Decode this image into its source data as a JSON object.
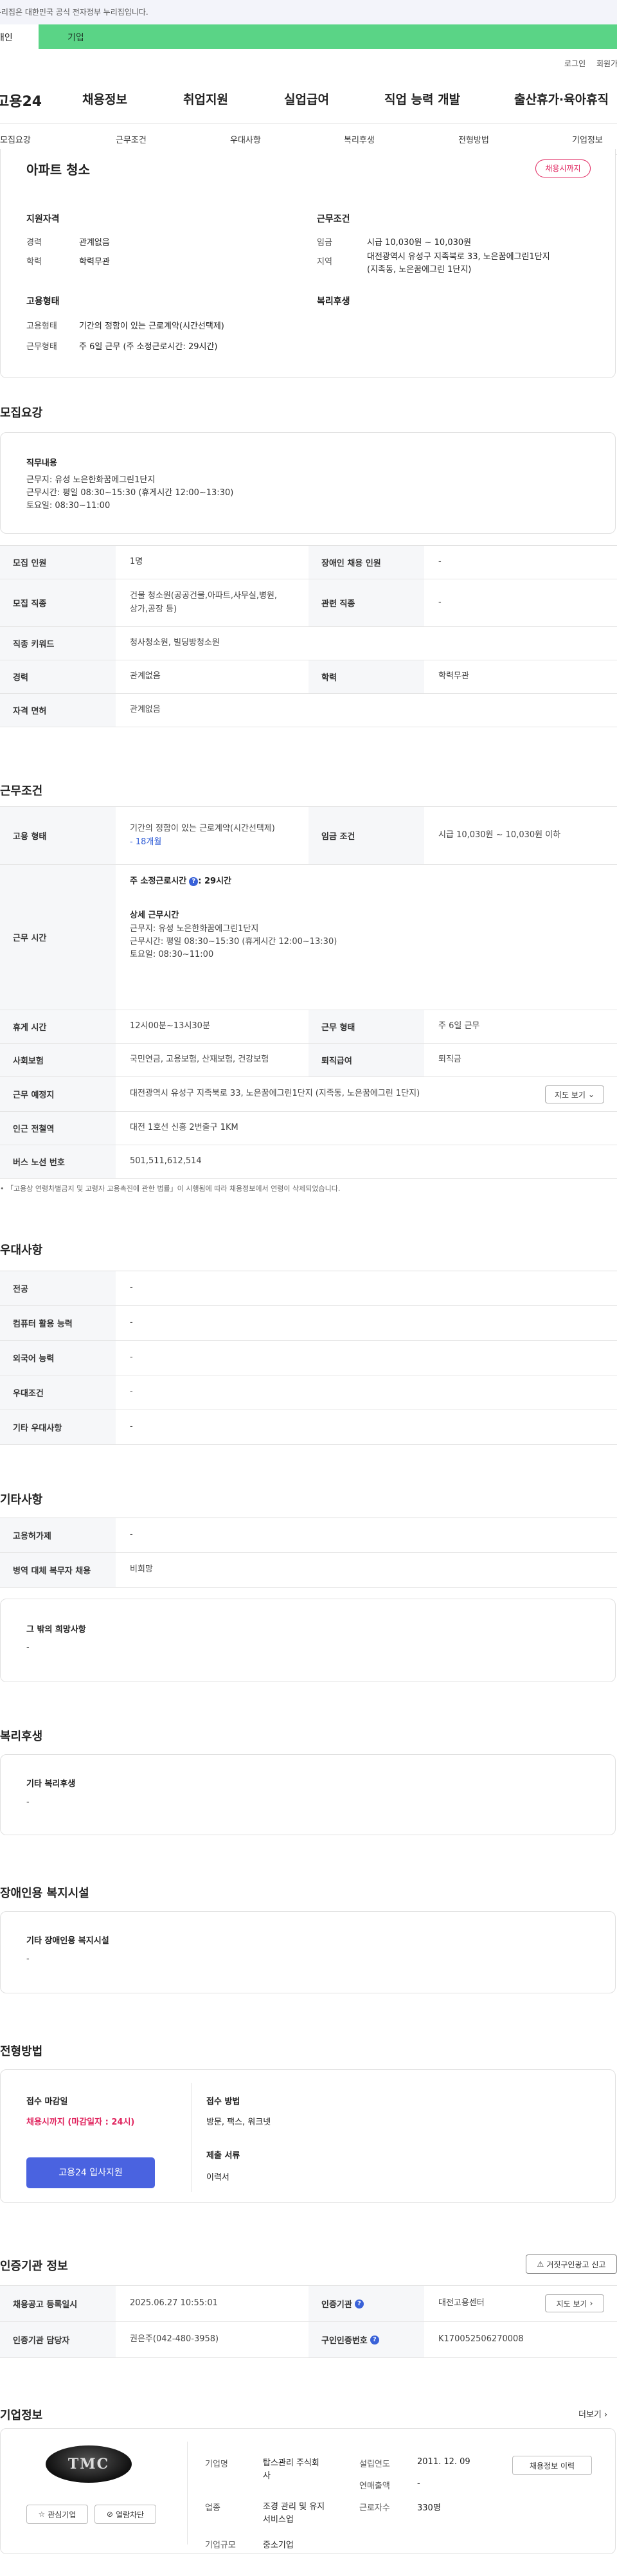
{
  "gov_banner": "이 누리집은 대한민국 공식 전자정부 누리집입니다.",
  "audience_tabs": [
    "개인",
    "기업"
  ],
  "util": {
    "login": "로그인",
    "join": "회원가입"
  },
  "logo": "고용24",
  "gnb": [
    "채용정보",
    "취업지원",
    "실업급여",
    "직업 능력 개발",
    "출산휴가·육아휴직"
  ],
  "tabs": [
    "모집요강",
    "근무조건",
    "우대사항",
    "복리후생",
    "전형방법",
    "기업정보"
  ],
  "summary": {
    "title": "아파트 청소",
    "badge": "채용시까지",
    "qual_heading": "지원자격",
    "career_label": "경력",
    "career_value": "관계없음",
    "edu_label": "학력",
    "edu_value": "학력무관",
    "cond_heading": "근무조건",
    "wage_label": "임금",
    "wage_value": "시급 10,030원 ~ 10,030원",
    "region_label": "지역",
    "region_value": "대전광역시 유성구 지족북로 33, 노은꿈에그린1단지\n(지족동, 노은꿈에그린 1단지)",
    "emp_heading": "고용형태",
    "type_label": "고용형태",
    "type_value": "기간의 정함이 있는 근로계약(시간선택제)",
    "form_label": "근무형태",
    "form_value": "주 6일 근무 (주 소정근로시간: 29시간)",
    "welfare_heading": "복리후생"
  },
  "recruit": {
    "heading": "모집요강",
    "duty_title": "직무내용",
    "duty_text": "근무지: 유성 노은한화꿈에그린1단지\n근무시간: 평일 08:30~15:30 (휴게시간 12:00~13:30)\n토요일: 08:30~11:00",
    "rows": [
      {
        "k1": "모집 인원",
        "v1": "1명",
        "k2": "장애인 채용 인원",
        "v2": "-"
      },
      {
        "k1": "모집 직종",
        "v1": "건물 청소원(공공건물,아파트,사무실,병원,\n상가,공장 등)",
        "k2": "관련 직종",
        "v2": "-"
      },
      {
        "k1": "직종 키워드",
        "v1": "청사청소원, 빌딩방청소원",
        "k2": "",
        "v2": ""
      },
      {
        "k1": "경력",
        "v1": "관계없음",
        "k2": "학력",
        "v2": "학력무관"
      },
      {
        "k1": "자격 면허",
        "v1": "관계없음",
        "k2": "",
        "v2": ""
      }
    ]
  },
  "work": {
    "heading": "근무조건",
    "emp_type_k": "고용 형태",
    "emp_type_v": "기간의 정함이 있는 근로계약(시간선택제)",
    "emp_type_period": "- 18개월",
    "wage_k": "임금 조건",
    "wage_v": "시급 10,030원 ~ 10,030원 이하",
    "hours_k": "근무 시간",
    "hours_week": "주 소정근로시간",
    "hours_week_val": ": 29시간",
    "hours_detail_title": "상세 근무시간",
    "hours_detail": "근무지: 유성 노은한화꿈에그린1단지\n근무시간: 평일 08:30~15:30 (휴게시간 12:00~13:30)\n토요일: 08:30~11:00",
    "break_k": "휴게 시간",
    "break_v": "12시00분~13시30분",
    "form_k": "근무 형태",
    "form_v": "주 6일 근무",
    "ins_k": "사회보험",
    "ins_v": "국민연금, 고용보험, 산재보험, 건강보험",
    "sev_k": "퇴직급여",
    "sev_v": "퇴직금",
    "place_k": "근무 예정지",
    "place_v": "대전광역시 유성구 지족북로 33, 노은꿈에그린1단지 (지족동, 노은꿈에그린 1단지)",
    "map_btn": "지도 보기",
    "subway_k": "인근 전철역",
    "subway_v": "대전 1호선 신흥 2번출구 1KM",
    "bus_k": "버스 노선 번호",
    "bus_v": "501,511,612,514",
    "note": "「고용상 연령차별금지 및 고령자 고용촉진에 관한 법률」이 시행됨에 따라 채용정보에서 연령이 삭제되었습니다."
  },
  "pref": {
    "heading": "우대사항",
    "rows": [
      {
        "k": "전공",
        "v": "-"
      },
      {
        "k": "컴퓨터 활용 능력",
        "v": "-"
      },
      {
        "k": "외국어 능력",
        "v": "-"
      },
      {
        "k": "우대조건",
        "v": "-"
      },
      {
        "k": "기타 우대사항",
        "v": "-"
      }
    ]
  },
  "etc": {
    "heading": "기타사항",
    "rows": [
      {
        "k": "고용허가제",
        "v": "-"
      },
      {
        "k": "병역 대체 복무자 채용",
        "v": "비희망"
      }
    ],
    "extra_title": "그 밖의 희망사항",
    "extra_value": "-"
  },
  "welfare": {
    "heading": "복리후생",
    "sub": "기타 복리후생",
    "value": "-"
  },
  "disabled": {
    "heading": "장애인용 복지시설",
    "sub": "기타 장애인용 복지시설",
    "value": "-"
  },
  "process": {
    "heading": "전형방법",
    "deadline_title": "접수 마감일",
    "deadline_value": "채용시까지 (마감일자 : 24시)",
    "apply_btn": "고용24 입사지원",
    "method_title": "접수 방법",
    "method_value": "방문, 팩스, 워크넷",
    "docs_title": "제출 서류",
    "docs_value": "이력서"
  },
  "agency": {
    "heading": "인증기관 정보",
    "report_btn": "거짓구인광고 신고",
    "reg_k": "채용공고 등록일시",
    "reg_v": "2025.06.27 10:55:01",
    "agency_k": "인증기관",
    "agency_v": "대전고용센터",
    "map_btn": "지도 보기",
    "mgr_k": "인증기관 담당자",
    "mgr_v": "권은주(042-480-3958)",
    "num_k": "구인인증번호",
    "num_v": "K170052506270008"
  },
  "company": {
    "heading": "기업정보",
    "more": "더보기",
    "logo_text": "TMC",
    "fav_btn": "관심기업",
    "block_btn": "열람차단",
    "name_k": "기업명",
    "name_v": "탑스관리 주식회\n사",
    "year_k": "설립연도",
    "year_v": "2011. 12. 09",
    "info_btn": "채용정보 이력",
    "sales_k": "연매출액",
    "sales_v": "-",
    "biz_k": "업종",
    "biz_v": "조경 관리 및 유지\n서비스업",
    "emp_k": "근로자수",
    "emp_v": "330명",
    "size_k": "기업규모",
    "size_v": "중소기업"
  }
}
